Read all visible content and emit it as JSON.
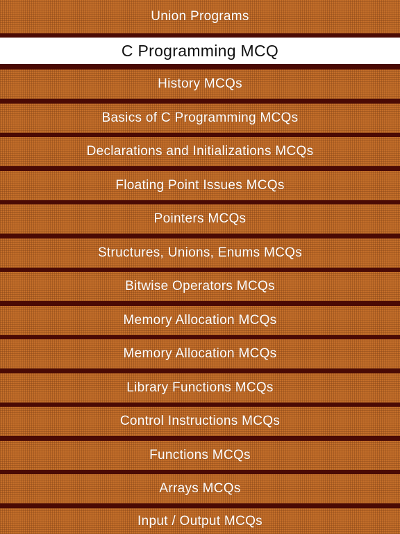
{
  "top_item": "Union Programs",
  "header": {
    "title": "C Programming MCQ"
  },
  "menu": {
    "items": [
      "History MCQs",
      "Basics of C Programming MCQs",
      "Declarations and Initializations MCQs",
      "Floating Point Issues MCQs",
      "Pointers MCQs",
      "Structures, Unions, Enums MCQs",
      "Bitwise Operators MCQs",
      "Memory Allocation MCQs",
      "Memory Allocation MCQs",
      "Library Functions MCQs",
      "Control Instructions MCQs",
      "Functions MCQs",
      "Arrays MCQs",
      "Input / Output MCQs"
    ]
  },
  "colors": {
    "item_background": "#c46f2a",
    "separator": "#4a0a04",
    "header_background": "#ffffff"
  }
}
